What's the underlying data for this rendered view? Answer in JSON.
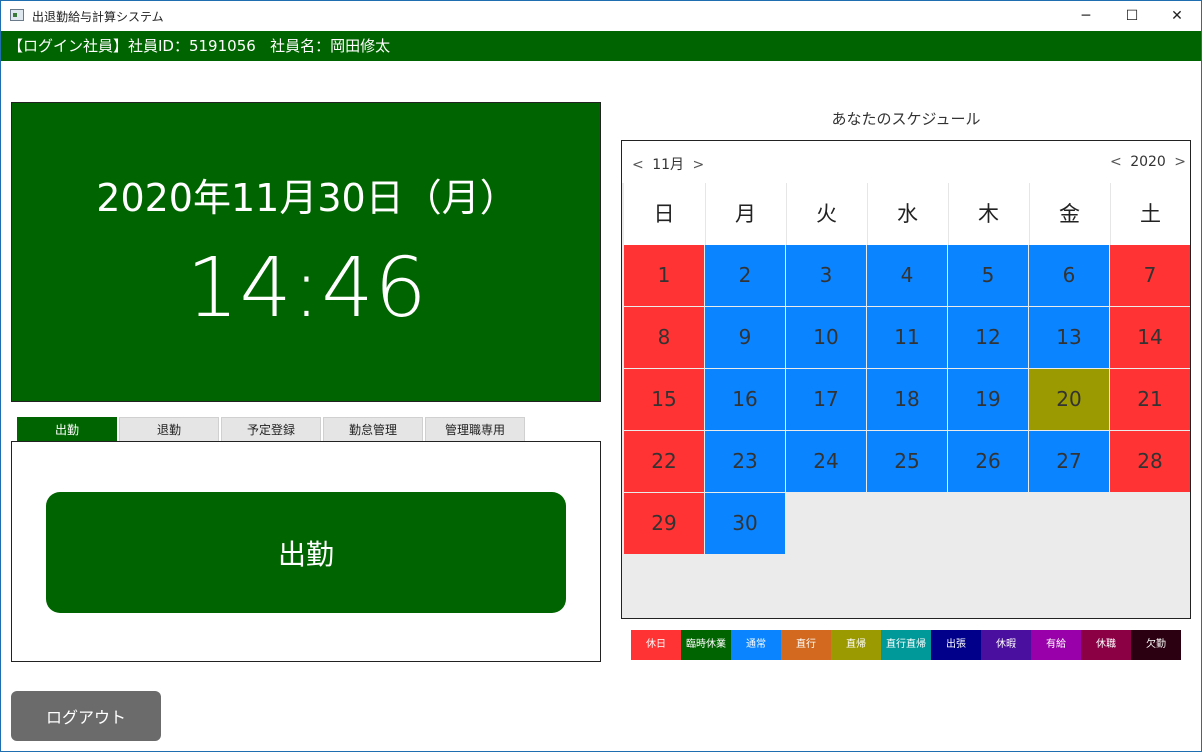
{
  "window": {
    "title": "出退勤給与計算システム",
    "minimize": "─",
    "maximize": "☐",
    "close": "✕"
  },
  "login": {
    "prefix": "【ログイン社員】社員ID：5191056",
    "name_text": "社員名：岡田修太"
  },
  "clock": {
    "date": "2020年11月30日（月）",
    "time": "14:46"
  },
  "tabs": [
    {
      "label": "出勤",
      "active": true
    },
    {
      "label": "退勤"
    },
    {
      "label": "予定登録"
    },
    {
      "label": "勤怠管理"
    },
    {
      "label": "管理職専用"
    }
  ],
  "clockin_button": "出勤",
  "logout_button": "ログアウト",
  "schedule": {
    "title": "あなたのスケジュール",
    "month_label": "11月",
    "year_label": "2020",
    "prev_arrow": "<",
    "next_arrow": ">",
    "weekdays": [
      "日",
      "月",
      "火",
      "水",
      "木",
      "金",
      "土"
    ],
    "days": [
      {
        "d": "1",
        "color": "#ff3333"
      },
      {
        "d": "2",
        "color": "#0a84ff"
      },
      {
        "d": "3",
        "color": "#0a84ff"
      },
      {
        "d": "4",
        "color": "#0a84ff"
      },
      {
        "d": "5",
        "color": "#0a84ff"
      },
      {
        "d": "6",
        "color": "#0a84ff"
      },
      {
        "d": "7",
        "color": "#ff3333"
      },
      {
        "d": "8",
        "color": "#ff3333"
      },
      {
        "d": "9",
        "color": "#0a84ff"
      },
      {
        "d": "10",
        "color": "#0a84ff"
      },
      {
        "d": "11",
        "color": "#0a84ff"
      },
      {
        "d": "12",
        "color": "#0a84ff"
      },
      {
        "d": "13",
        "color": "#0a84ff"
      },
      {
        "d": "14",
        "color": "#ff3333"
      },
      {
        "d": "15",
        "color": "#ff3333"
      },
      {
        "d": "16",
        "color": "#0a84ff"
      },
      {
        "d": "17",
        "color": "#0a84ff"
      },
      {
        "d": "18",
        "color": "#0a84ff"
      },
      {
        "d": "19",
        "color": "#0a84ff"
      },
      {
        "d": "20",
        "color": "#9b9a00"
      },
      {
        "d": "21",
        "color": "#ff3333"
      },
      {
        "d": "22",
        "color": "#ff3333"
      },
      {
        "d": "23",
        "color": "#0a84ff"
      },
      {
        "d": "24",
        "color": "#0a84ff"
      },
      {
        "d": "25",
        "color": "#0a84ff"
      },
      {
        "d": "26",
        "color": "#0a84ff"
      },
      {
        "d": "27",
        "color": "#0a84ff"
      },
      {
        "d": "28",
        "color": "#ff3333"
      },
      {
        "d": "29",
        "color": "#ff3333"
      },
      {
        "d": "30",
        "color": "#0a84ff"
      }
    ]
  },
  "legend": [
    {
      "label": "休日",
      "color": "#ff3333"
    },
    {
      "label": "臨時休業",
      "color": "#006400"
    },
    {
      "label": "通常",
      "color": "#0a84ff"
    },
    {
      "label": "直行",
      "color": "#d2691e"
    },
    {
      "label": "直帰",
      "color": "#9b9a00"
    },
    {
      "label": "直行直帰",
      "color": "#009999"
    },
    {
      "label": "出張",
      "color": "#00008b"
    },
    {
      "label": "休暇",
      "color": "#4b0fa0"
    },
    {
      "label": "有給",
      "color": "#9900aa"
    },
    {
      "label": "休職",
      "color": "#8b0045"
    },
    {
      "label": "欠勤",
      "color": "#2b0010"
    }
  ]
}
